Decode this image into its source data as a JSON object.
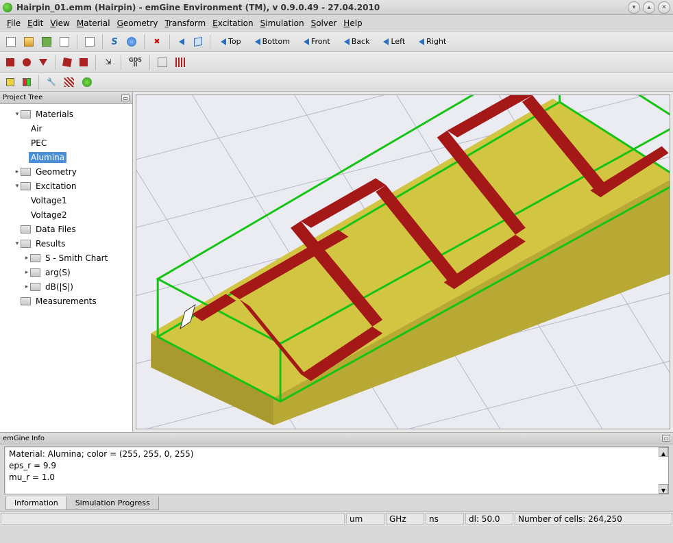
{
  "titlebar": {
    "title": "Hairpin_01.emm (Hairpin) - emGine Environment (TM), v 0.9.0.49 - 27.04.2010"
  },
  "menubar": [
    {
      "label": "File",
      "u": "F",
      "rest": "ile"
    },
    {
      "label": "Edit",
      "u": "E",
      "rest": "dit"
    },
    {
      "label": "View",
      "u": "V",
      "rest": "iew"
    },
    {
      "label": "Material",
      "u": "M",
      "rest": "aterial"
    },
    {
      "label": "Geometry",
      "u": "G",
      "rest": "eometry"
    },
    {
      "label": "Transform",
      "u": "T",
      "rest": "ransform"
    },
    {
      "label": "Excitation",
      "u": "E",
      "rest": "xcitation"
    },
    {
      "label": "Simulation",
      "u": "S",
      "rest": "imulation"
    },
    {
      "label": "Solver",
      "u": "S",
      "rest": "olver"
    },
    {
      "label": "Help",
      "u": "H",
      "rest": "elp"
    }
  ],
  "toolbar1": {
    "views": [
      "Top",
      "Bottom",
      "Front",
      "Back",
      "Left",
      "Right"
    ]
  },
  "panels": {
    "tree_title": "Project Tree",
    "info_title": "emGine Info"
  },
  "tree": {
    "materials": "Materials",
    "air": "Air",
    "pec": "PEC",
    "alumina": "Alumina",
    "geometry": "Geometry",
    "excitation": "Excitation",
    "voltage1": "Voltage1",
    "voltage2": "Voltage2",
    "datafiles": "Data Files",
    "results": "Results",
    "smith": "S - Smith Chart",
    "args": "arg(S)",
    "dbs": "dB(|S|)",
    "measurements": "Measurements"
  },
  "info": {
    "line1": "Material: Alumina; color = (255, 255, 0, 255)",
    "line2": " eps_r = 9.9",
    "line3": " mu_r = 1.0"
  },
  "tabs": {
    "info": "Information",
    "sim": "Simulation Progress"
  },
  "status": {
    "unit_len": "um",
    "unit_freq": "GHz",
    "unit_time": "ns",
    "dl": "dl: 50.0",
    "cells": "Number of cells: 264,250"
  }
}
